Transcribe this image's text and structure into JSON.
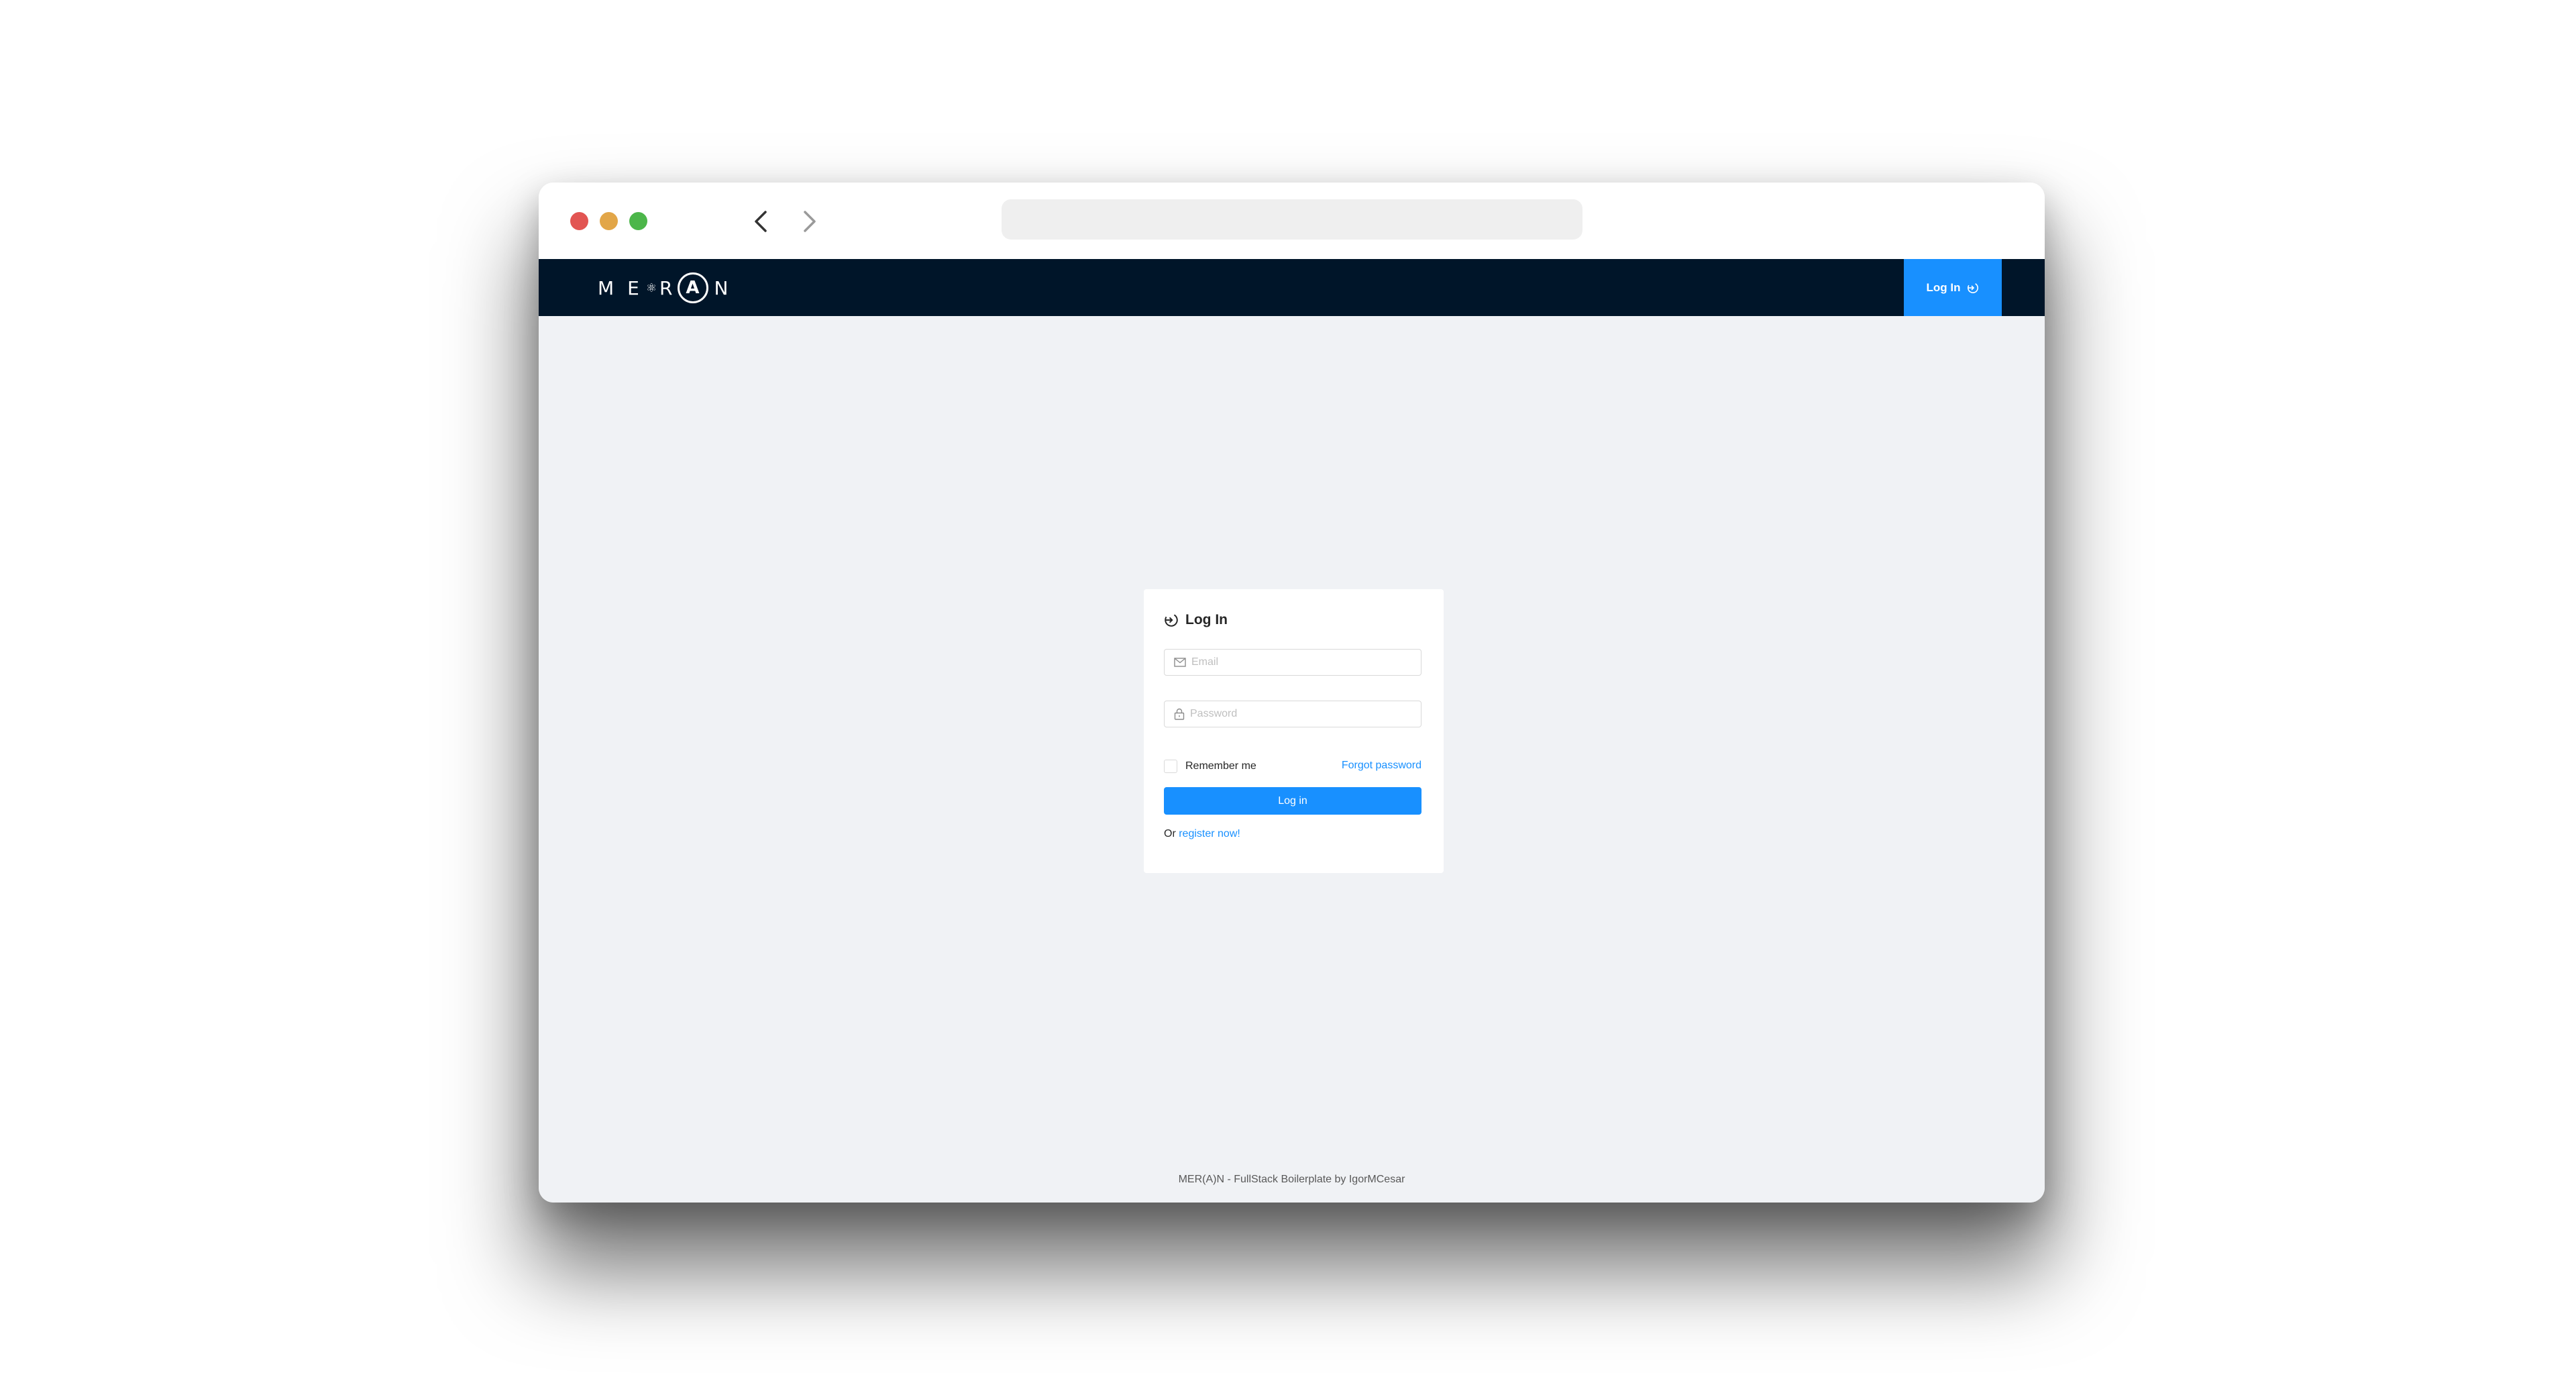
{
  "window_controls": {
    "close": "close-control",
    "minimize": "minimize-control",
    "maximize": "maximize-control"
  },
  "colors": {
    "header_bg": "#001529",
    "primary": "#1890ff",
    "content_bg": "#f0f2f5"
  },
  "header": {
    "logo_letters": [
      "M",
      "E",
      "R",
      "A",
      "N"
    ],
    "login_label": "Log In",
    "login_icon": "login-icon"
  },
  "login_card": {
    "title": "Log In",
    "title_icon": "login-icon",
    "email": {
      "placeholder": "Email",
      "value": "",
      "icon": "mail-icon"
    },
    "password": {
      "placeholder": "Password",
      "value": "",
      "icon": "lock-icon"
    },
    "remember_label": "Remember me",
    "remember_checked": false,
    "forgot_label": "Forgot password",
    "submit_label": "Log in",
    "register_prefix": "Or",
    "register_link": "register now!"
  },
  "footer": {
    "text": "MER(A)N - FullStack Boilerplate by IgorMCesar"
  }
}
